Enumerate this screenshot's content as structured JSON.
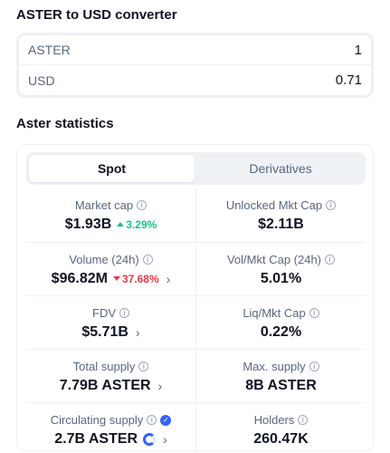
{
  "converter": {
    "title": "ASTER to USD converter",
    "from": {
      "label": "ASTER",
      "value": "1"
    },
    "to": {
      "label": "USD",
      "value": "0.71"
    }
  },
  "stats": {
    "title": "Aster statistics",
    "tabs": {
      "spot": "Spot",
      "derivatives": "Derivatives"
    },
    "market_cap": {
      "label": "Market cap",
      "value": "$1.93B",
      "change": "3.29%",
      "direction": "up"
    },
    "unlocked_mkt_cap": {
      "label": "Unlocked Mkt Cap",
      "value": "$2.11B"
    },
    "volume": {
      "label": "Volume (24h)",
      "value": "$96.82M",
      "change": "37.68%",
      "direction": "down"
    },
    "vol_mkt_cap": {
      "label": "Vol/Mkt Cap (24h)",
      "value": "5.01%"
    },
    "fdv": {
      "label": "FDV",
      "value": "$5.71B"
    },
    "liq_mkt_cap": {
      "label": "Liq/Mkt Cap",
      "value": "0.22%"
    },
    "total_supply": {
      "label": "Total supply",
      "value": "7.79B ASTER"
    },
    "max_supply": {
      "label": "Max. supply",
      "value": "8B ASTER"
    },
    "circulating_supply": {
      "label": "Circulating supply",
      "value": "2.7B ASTER",
      "progress_fraction": 0.35
    },
    "holders": {
      "label": "Holders",
      "value": "260.47K"
    }
  },
  "icons": {
    "info": "info-icon",
    "verified": "verified-check-icon",
    "chevron": "chevron-right-icon"
  },
  "colors": {
    "up": "#16c784",
    "down": "#ea3943",
    "accent": "#3861fb"
  }
}
